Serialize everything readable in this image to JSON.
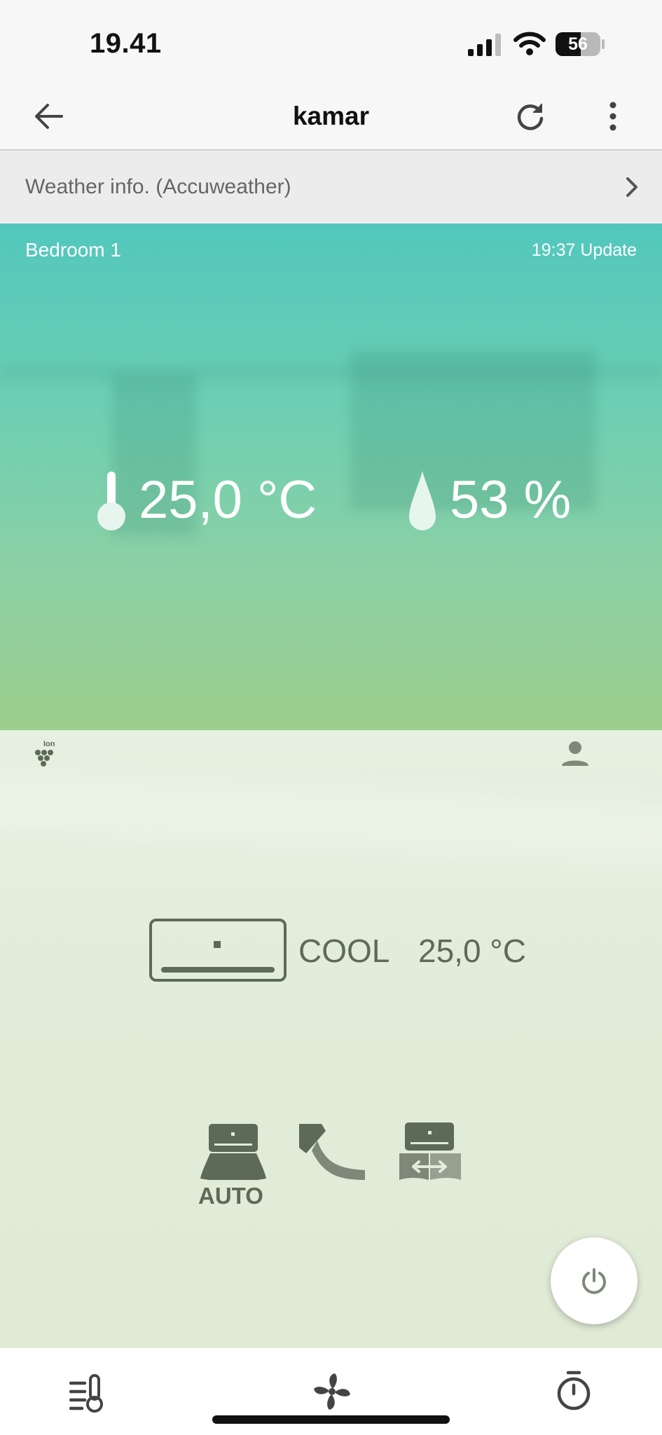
{
  "status_bar": {
    "time": "19.41",
    "battery": "56"
  },
  "header": {
    "title": "kamar"
  },
  "weather": {
    "label": "Weather info. (Accuweather)"
  },
  "room": {
    "name": "Bedroom 1",
    "update": "19:37 Update",
    "temperature": "25,0 °C",
    "humidity": "53 %"
  },
  "ac": {
    "ion_label": "Ion",
    "mode": "COOL",
    "set_temperature": "25,0 °C",
    "fan_label": "AUTO"
  },
  "colors": {
    "hero_top": "#52c7bd",
    "hero_bottom": "#9cce8c",
    "control_bg": "#e2ecda",
    "icon_dark": "#5d6a58"
  },
  "icons": [
    "back-arrow-icon",
    "refresh-icon",
    "more-vert-icon",
    "chevron-right-icon",
    "thermometer-icon",
    "droplet-icon",
    "ion-icon",
    "person-icon",
    "indoor-unit-icon",
    "fan-auto-icon",
    "airflow-direction-icon",
    "swing-icon",
    "power-icon",
    "temperature-list-icon",
    "fan-icon",
    "timer-icon"
  ]
}
